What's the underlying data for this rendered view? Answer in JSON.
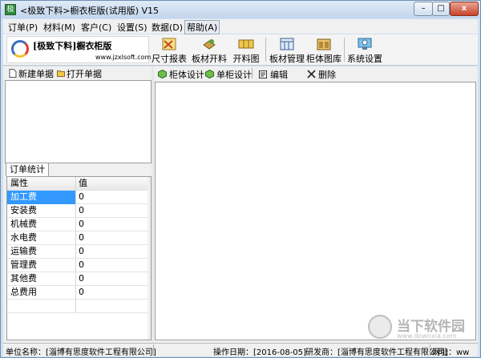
{
  "window": {
    "title": "<极致下料>橱衣柜版(试用版) V15",
    "icon_glyph": "极"
  },
  "window_controls": {
    "minimize": "–",
    "maximize": "□",
    "close": "x"
  },
  "menu": [
    {
      "label": "订单(P)"
    },
    {
      "label": "材料(M)"
    },
    {
      "label": "客户(C)"
    },
    {
      "label": "设置(S)"
    },
    {
      "label": "数据(D)"
    },
    {
      "label": "帮助(A)"
    }
  ],
  "logo": {
    "title": "[极致下料]橱衣柜版",
    "url": "www.jzxlsoft.com"
  },
  "toolbar": [
    {
      "label": "尺寸报表",
      "icon": "ruler-report-icon"
    },
    {
      "label": "板材开料",
      "icon": "board-cutting-icon"
    },
    {
      "label": "开料图",
      "icon": "cutting-diagram-icon"
    },
    {
      "label": "板材管理",
      "icon": "board-management-icon"
    },
    {
      "label": "柜体图库",
      "icon": "cabinet-library-icon"
    },
    {
      "label": "系统设置",
      "icon": "system-settings-icon"
    }
  ],
  "left_panel": {
    "new_order": "新建单据",
    "open_order": "打开单据",
    "tab_label": "订单统计",
    "grid_headers": {
      "attribute": "属性",
      "value": "值"
    },
    "rows": [
      {
        "attribute": "加工费",
        "value": "0"
      },
      {
        "attribute": "安装费",
        "value": "0"
      },
      {
        "attribute": "机械费",
        "value": "0"
      },
      {
        "attribute": "水电费",
        "value": "0"
      },
      {
        "attribute": "运输费",
        "value": "0"
      },
      {
        "attribute": "管理费",
        "value": "0"
      },
      {
        "attribute": "其他费",
        "value": "0"
      },
      {
        "attribute": "总费用",
        "value": "0"
      }
    ]
  },
  "right_panel": {
    "cabinet_design": "柜体设计",
    "single_design": "单柜设计",
    "edit": "编辑",
    "delete": "删除"
  },
  "status": {
    "company": "单位名称：[淄博有思度软件工程有限公司]",
    "date": "操作日期：[2016-08-05]",
    "developer": "研发商：[淄博有思度软件工程有限公司]",
    "website": "网址：ww"
  },
  "watermark": {
    "name": "当下软件园",
    "url": "www.downxia.com"
  },
  "colors": {
    "selection": "#3399ff",
    "window_frame": "#cfe0f2",
    "close_button": "#c9442b"
  }
}
